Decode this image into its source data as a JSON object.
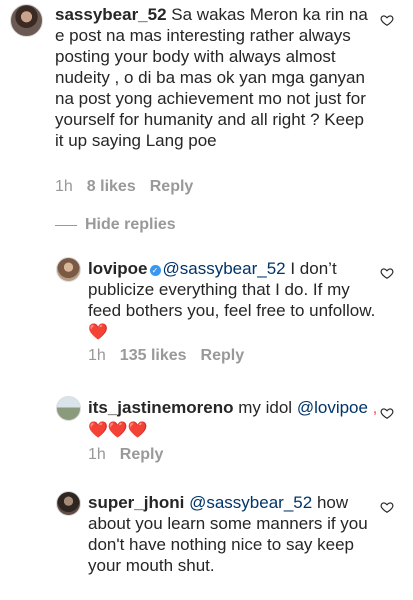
{
  "comments": [
    {
      "username": "sassybear_52",
      "text": "Sa wakas Meron ka rin na e post na mas interesting rather always posting your body with always almost nudeity , o di ba mas ok yan mga ganyan na post yong achievement mo not just for yourself for humanity and all right ? Keep it up saying Lang poe",
      "time": "1h",
      "likes": "8 likes",
      "reply_label": "Reply"
    }
  ],
  "hide_replies_label": "Hide replies",
  "replies": [
    {
      "username": "lovipoe",
      "verified_icon": "verified-badge-icon",
      "mention": "@sassybear_52",
      "text": "I don’t publicize everything that I do. If my feed bothers you, feel free to unfollow.",
      "emoji": "❤️",
      "time": "1h",
      "likes": "135 likes",
      "reply_label": "Reply"
    },
    {
      "username": "its_jastinemoreno",
      "text": "my idol",
      "mention": "@lovipoe",
      "emoji": ", ❤️❤️❤️",
      "time": "1h",
      "reply_label": "Reply"
    },
    {
      "username": "super_jhoni",
      "mention": "@sassybear_52",
      "text": "how about you learn some manners if you don't have nothing nice to say keep your mouth shut."
    }
  ],
  "icons": {
    "like": "heart-outline-icon"
  },
  "colors": {
    "text": "#262626",
    "meta": "#999999",
    "mention": "#003569",
    "heart": "#ed4956",
    "verified": "#3897f0"
  }
}
